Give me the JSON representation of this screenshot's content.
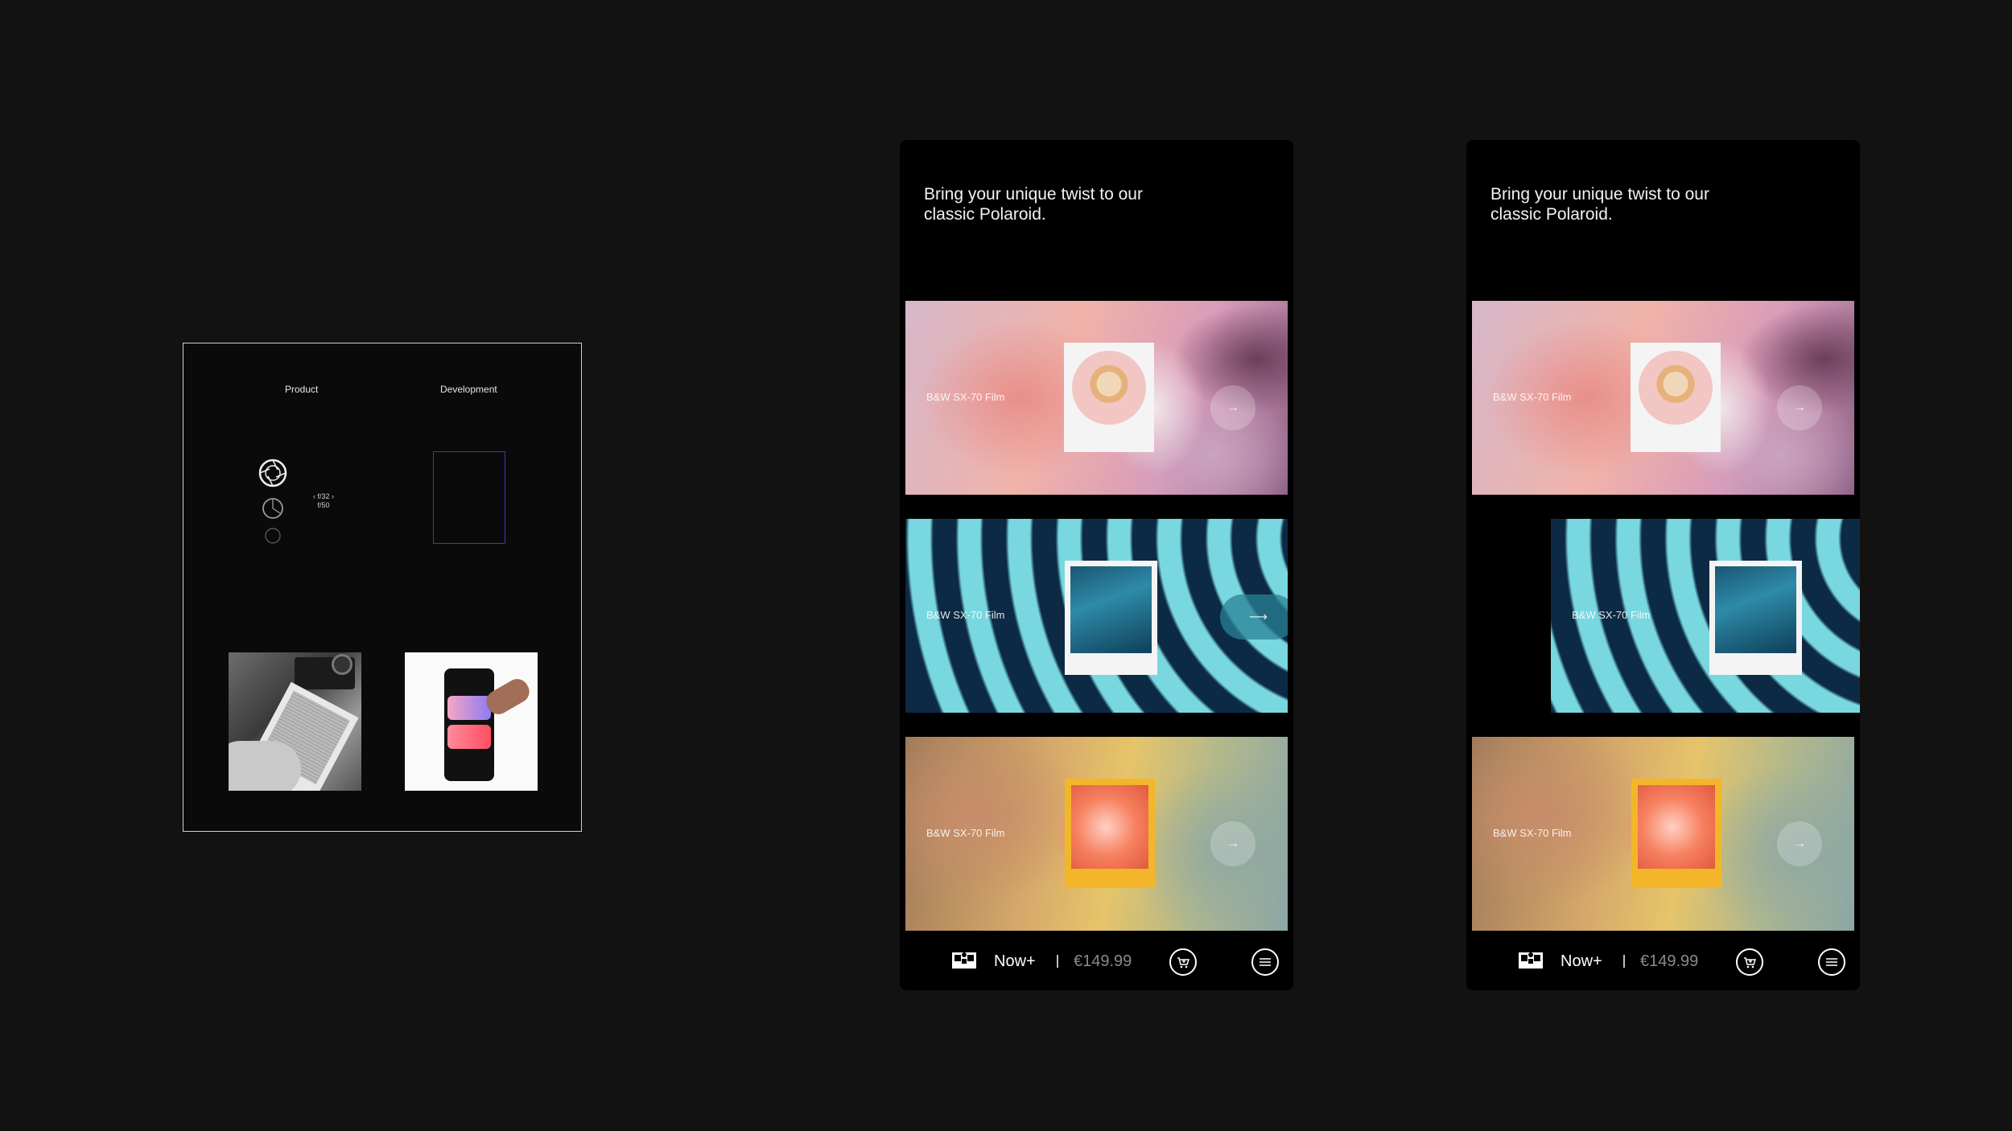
{
  "panel": {
    "col_product": "Product",
    "col_development": "Development",
    "fvalue_top": "‹ f/32 ›",
    "fvalue_bottom": "f/50"
  },
  "phones": [
    {
      "headline": "Bring your unique twist to our classic Polaroid.",
      "cards": [
        {
          "label": "B&W SX-70 Film",
          "arrow": "→"
        },
        {
          "label": "B&W SX-70 Film",
          "arrow": "⟶"
        },
        {
          "label": "B&W SX-70 Film",
          "arrow": "→"
        }
      ],
      "bar": {
        "product": "Now+",
        "price": "€149.99"
      }
    },
    {
      "headline": "Bring your unique twist to our classic Polaroid.",
      "cards": [
        {
          "label": "B&W SX-70 Film",
          "arrow": "→"
        },
        {
          "label": "B&W SX-70 Film"
        },
        {
          "label": "B&W SX-70 Film",
          "arrow": "→"
        }
      ],
      "bar": {
        "product": "Now+",
        "price": "€149.99"
      }
    }
  ],
  "icons": {
    "aperture": "aperture-icon",
    "logo": "polaroid-logo-icon",
    "cart": "cart-icon",
    "menu": "menu-icon"
  },
  "colors": {
    "background": "#121212",
    "dev_frame": "#4a30c8",
    "teal_button": "#2882a0"
  }
}
